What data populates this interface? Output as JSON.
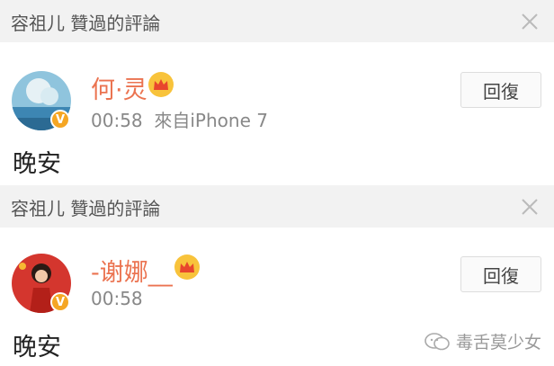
{
  "comments": [
    {
      "liked_by": "容祖儿 贊過的評論",
      "username": "何·灵",
      "time": "00:58",
      "source": "來自iPhone 7",
      "reply_label": "回復",
      "text": "晚安",
      "badge": "V"
    },
    {
      "liked_by": "容祖儿 贊過的評論",
      "username": "-谢娜__",
      "time": "00:58",
      "source": "",
      "reply_label": "回復",
      "text": "晚安",
      "badge": "V"
    }
  ],
  "watermark": {
    "text": "毒舌莫少女"
  },
  "colors": {
    "username": "#eb7350",
    "liked_bar": "#f2f2f2",
    "badge": "#f5a623",
    "crown": "#f8c33b"
  },
  "icons": [
    "close-icon",
    "crown-icon",
    "verified-badge-icon",
    "wechat-icon"
  ]
}
